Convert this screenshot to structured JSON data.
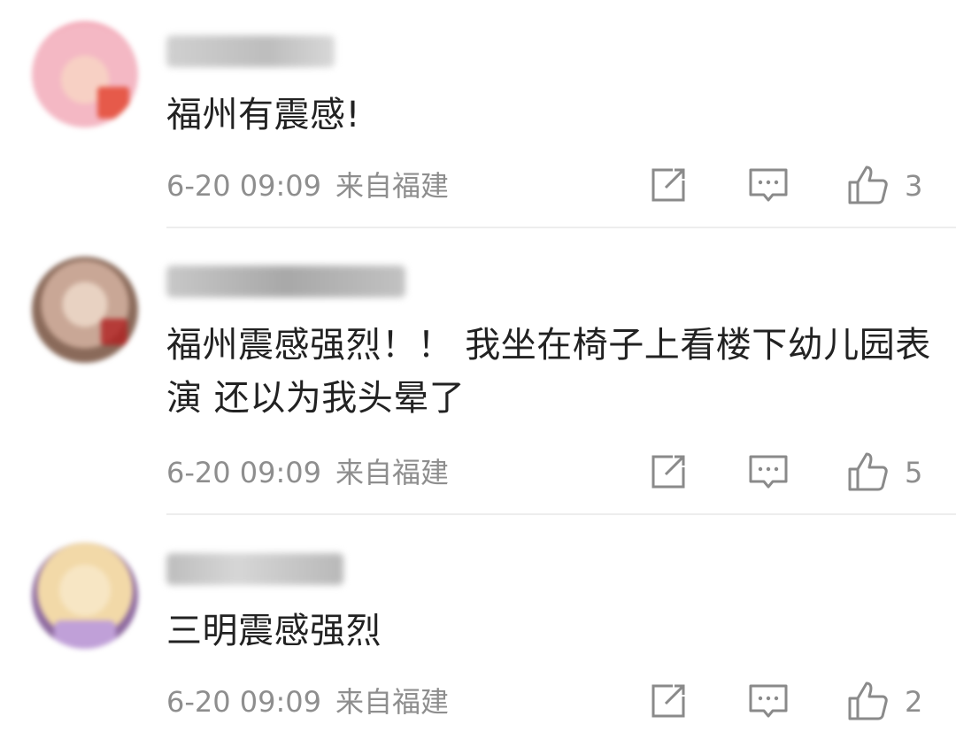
{
  "comments": [
    {
      "text": "福州有震感!",
      "time": "6-20 09:09",
      "location": "来自福建",
      "likes": "3",
      "avatar_colors": [
        "#f4b8c4",
        "#f2a0b0",
        "#e65a4a"
      ],
      "username_color": "#c8c8c8"
    },
    {
      "text": "福州震感强烈！！ 我坐在椅子上看楼下幼儿园表演 还以为我头晕了",
      "time": "6-20 09:09",
      "location": "来自福建",
      "likes": "5",
      "avatar_colors": [
        "#8a6a5a",
        "#d7b8a8",
        "#b02020"
      ],
      "username_color": "#b8b8b8"
    },
    {
      "text": "三明震感强烈",
      "time": "6-20 09:09",
      "location": "来自福建",
      "likes": "2",
      "avatar_colors": [
        "#8e6aa0",
        "#f2d9a8",
        "#c0a0d8"
      ],
      "username_color": "#c4c4c4"
    }
  ],
  "icons": {
    "share": "share-icon",
    "reply": "comment-icon",
    "like": "thumbs-up-icon"
  },
  "colors": {
    "text": "#222222",
    "meta": "#8e8e8e",
    "icon": "#8a8a8a",
    "divider": "#ededed"
  }
}
